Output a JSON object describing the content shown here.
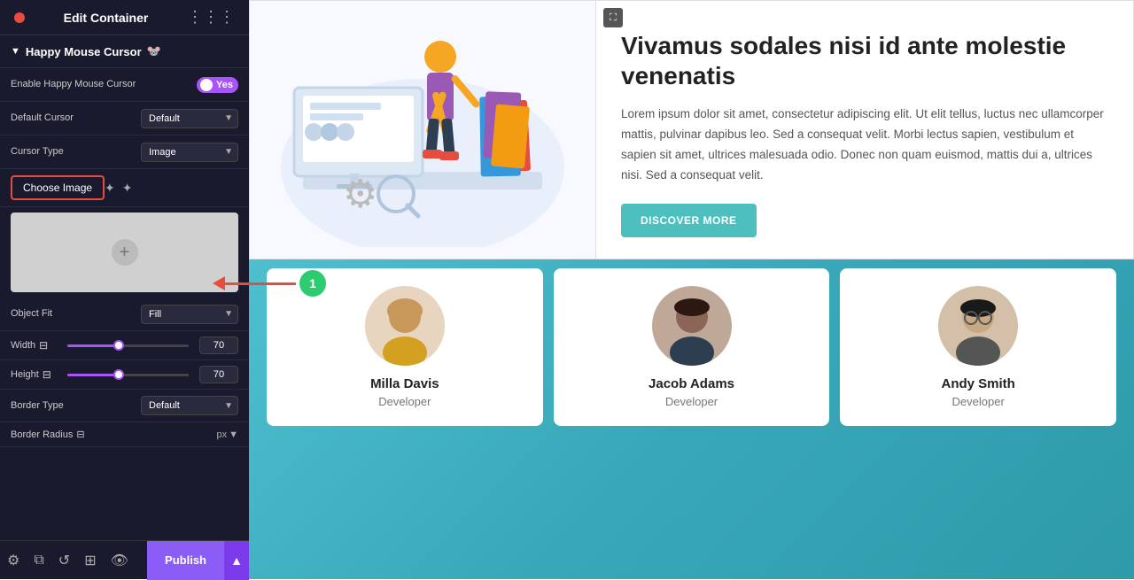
{
  "panel": {
    "header": {
      "title": "Edit Container",
      "dots_label": "⋮⋮⋮"
    },
    "section": {
      "label": "Happy Mouse Cursor",
      "emoji": "🐭"
    },
    "enable_label": "Enable Happy Mouse Cursor",
    "toggle_yes": "Yes",
    "default_cursor_label": "Default Cursor",
    "default_cursor_value": "Default",
    "cursor_type_label": "Cursor Type",
    "cursor_type_value": "Image",
    "choose_image_label": "Choose Image",
    "object_fit_label": "Object Fit",
    "object_fit_value": "Fill",
    "width_label": "Width",
    "width_value": "70",
    "height_label": "Height",
    "height_value": "70",
    "border_type_label": "Border Type",
    "border_type_value": "Default",
    "border_radius_label": "Border Radius",
    "border_radius_unit": "px",
    "publish_label": "Publish"
  },
  "hero": {
    "title": "Vivamus sodales nisi id ante molestie venenatis",
    "body": "Lorem ipsum dolor sit amet, consectetur adipiscing elit. Ut elit tellus, luctus nec ullamcorper mattis, pulvinar dapibus leo. Sed a consequat velit. Morbi lectus sapien, vestibulum et sapien sit amet, ultrices malesuada odio. Donec non quam euismod, mattis dui a, ultrices nisi. Sed a consequat velit.",
    "discover_btn": "DISCOVER MORE"
  },
  "team": {
    "members": [
      {
        "name": "Milla Davis",
        "role": "Developer",
        "hair": "#c8975a",
        "skin": "#d4a574"
      },
      {
        "name": "Jacob Adams",
        "role": "Developer",
        "hair": "#2c1810",
        "skin": "#8b6555"
      },
      {
        "name": "Andy Smith",
        "role": "Developer",
        "hair": "#1a1a1a",
        "skin": "#c8a882"
      }
    ]
  },
  "icons": {
    "menu_dots": "⋮",
    "arrow": "▼",
    "plus": "+",
    "monitor": "⊟",
    "gear": "⚙",
    "settings": "⚙",
    "history": "↺",
    "copy": "⧉",
    "eye": "👁",
    "expand": "⛶",
    "step_number": "1"
  }
}
